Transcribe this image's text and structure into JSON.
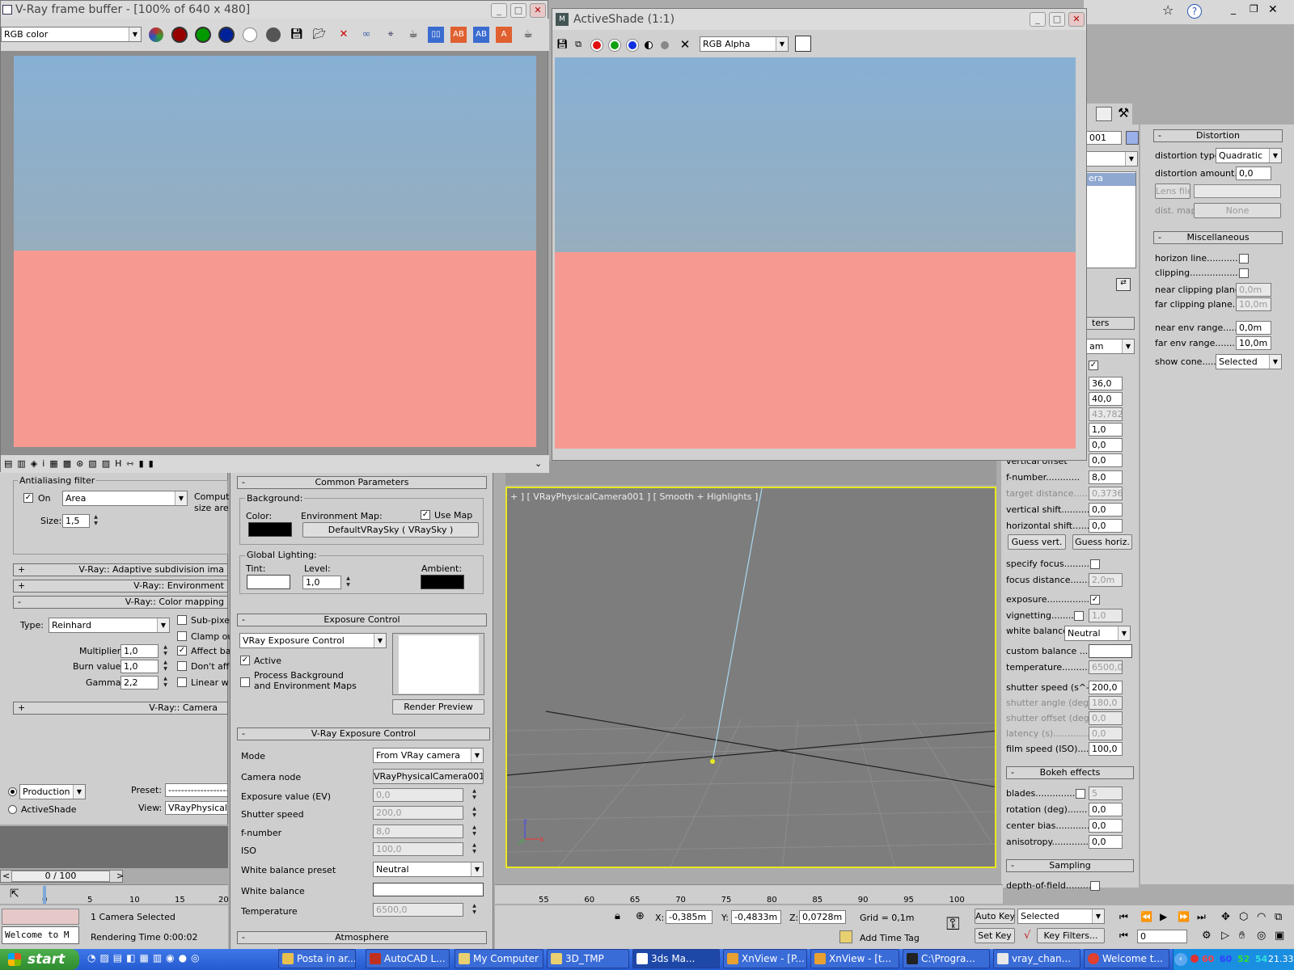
{
  "vfb": {
    "title": "V-Ray frame buffer - [100% of 640 x 480]",
    "channel": "RGB color",
    "sky_color": "#88b0d4",
    "ground_color": "#f69a91"
  },
  "activeshade": {
    "title": "ActiveShade (1:1)",
    "channel": "RGB Alpha"
  },
  "render_setup": {
    "aa_filter": {
      "heading": "Antialiasing filter",
      "on_label": "On",
      "filter": "Area",
      "size_label": "Size:",
      "size": "1,5",
      "compute": "Comput",
      "size_are": "size are"
    },
    "rollouts": {
      "adaptive": "V-Ray:: Adaptive subdivision ima",
      "environment": "V-Ray:: Environment",
      "color_mapping": "V-Ray:: Color mapping",
      "camera": "V-Ray:: Camera"
    },
    "color_mapping": {
      "type_label": "Type:",
      "type": "Reinhard",
      "multiplier_label": "Multiplier:",
      "multiplier": "1,0",
      "burn_label": "Burn value:",
      "burn": "1,0",
      "gamma_label": "Gamma:",
      "gamma": "2,2",
      "sub_pixel": "Sub-pixe",
      "clamp": "Clamp ou",
      "affect": "Affect ba",
      "dont": "Don't aff",
      "linear": "Linear w"
    },
    "production": "Production",
    "activeshade": "ActiveShade",
    "preset_label": "Preset:",
    "preset": "--------------------",
    "view_label": "View:",
    "view": "VRayPhysicalC"
  },
  "environment": {
    "common": "Common Parameters",
    "background": "Background:",
    "color_label": "Color:",
    "env_map_label": "Environment Map:",
    "use_map": "Use Map",
    "env_map": "DefaultVRaySky  ( VRaySky )",
    "global_lighting": "Global Lighting:",
    "tint": "Tint:",
    "level_label": "Level:",
    "level": "1,0",
    "ambient": "Ambient:",
    "exposure_control": "Exposure Control",
    "exposure_type": "VRay Exposure Control",
    "active": "Active",
    "process_bg": "Process Background",
    "and_env": "and Environment Maps",
    "render_preview": "Render Preview",
    "vray_exposure": "V-Ray Exposure Control",
    "mode_label": "Mode",
    "mode": "From VRay camera",
    "camera_node_label": "Camera node",
    "camera_node": "VRayPhysicalCamera001",
    "ev_label": "Exposure value (EV)",
    "ev": "0,0",
    "shutter_label": "Shutter speed",
    "shutter": "200,0",
    "fnum_label": "f-number",
    "fnum": "8,0",
    "iso_label": "ISO",
    "iso": "100,0",
    "wb_preset_label": "White balance preset",
    "wb_preset": "Neutral",
    "wb_label": "White balance",
    "temp_label": "Temperature",
    "temp": "6500,0",
    "atmosphere": "Atmosphere"
  },
  "viewport": {
    "label": "+ ] [ VRayPhysicalCamera001 ] [ Smooth + Highlights ]",
    "ticks": [
      "55",
      "60",
      "65",
      "70",
      "75",
      "80",
      "85",
      "90",
      "95",
      "100"
    ]
  },
  "cam_params": {
    "name": "001",
    "cera": "era",
    "ters": "ters",
    "am": "am",
    "values": [
      "36,0",
      "40,0",
      "43,782",
      "1,0",
      "0,0",
      "0,0"
    ],
    "vertical_offset": "vertical offset",
    "fnumber_label": "f-number............",
    "fnumber": "8,0",
    "target_distance_label": "target distance......",
    "target_distance": "0,3736r",
    "vshift_label": "vertical shift..........",
    "vshift": "0,0",
    "hshift_label": "horizontal shift.......",
    "hshift": "0,0",
    "guess_vert": "Guess vert.",
    "guess_horiz": "Guess horiz.",
    "specify_focus": "specify focus...........",
    "focus_distance_label": "focus distance.......",
    "focus_distance": "2,0m",
    "exposure": "exposure...............",
    "vignetting": "vignetting..........",
    "vignetting_value": "1,0",
    "white_balance": "white balance",
    "white_balance_value": "Neutral",
    "custom_balance": "custom balance .....",
    "temperature_label": "temperature..........",
    "temperature": "6500,0",
    "shutter_label": "shutter speed (s^-1",
    "shutter": "200,0",
    "angle_label": "shutter angle (deg)",
    "angle": "180,0",
    "offset_label": "shutter offset (deg)",
    "offset": "0,0",
    "latency_label": "latency (s).............",
    "latency": "0,0",
    "film_label": "film speed (ISO)......",
    "film": "100,0",
    "bokeh": "Bokeh effects",
    "blades_label": "blades..............",
    "blades": "5",
    "rotation_label": "rotation (deg).......",
    "rotation": "0,0",
    "center_label": "center bias............",
    "center": "0,0",
    "aniso_label": "anisotropy.............",
    "aniso": "0,0",
    "sampling": "Sampling",
    "dof": "depth-of-field........."
  },
  "distortion": {
    "heading": "Distortion",
    "type_label": "distortion type.",
    "type": "Quadratic",
    "amount_label": "distortion amount...",
    "amount": "0,0",
    "lens_file": "Lens file",
    "dist_map": "dist. map",
    "none": "None"
  },
  "misc": {
    "heading": "Miscellaneous",
    "horizon": "horizon line............",
    "clipping": "clipping..................",
    "near_clip_label": "near clipping plane..",
    "near_clip": "0,0m",
    "far_clip_label": "far clipping plane....",
    "far_clip": "10,0m",
    "near_env_label": "near env range......",
    "near_env": "0,0m",
    "far_env_label": "far env range.......",
    "far_env": "10,0m",
    "show_cone_label": "show cone.......",
    "show_cone": "Selected"
  },
  "status": {
    "frames": "0 / 100",
    "timeline": [
      "0",
      "5",
      "10",
      "15",
      "20"
    ],
    "selected": "1 Camera Selected",
    "rendering": "Rendering Time  0:00:02",
    "welcome": "Welcome to M",
    "x_label": "X:",
    "x": "-0,385m",
    "y_label": "Y:",
    "y": "-0,4833m",
    "z_label": "Z:",
    "z": "0,0728m",
    "grid": "Grid = 0,1m",
    "add_time_tag": "Add Time Tag",
    "auto_key": "Auto Key",
    "set_key": "Set Key",
    "selected_dd": "Selected",
    "key_filters": "Key Filters...",
    "frame": "0"
  },
  "taskbar": {
    "start": "start",
    "items": [
      "Posta in ar...",
      "AutoCAD L...",
      "My Computer",
      "3D_TMP",
      "3ds Ma...",
      "XnView - [P...",
      "XnView - [t...",
      "C:\\Progra...",
      "vray_chan...",
      "Welcome t..."
    ],
    "tray_nums": [
      "60",
      "60",
      "52",
      "54"
    ],
    "clock": "21.33"
  }
}
